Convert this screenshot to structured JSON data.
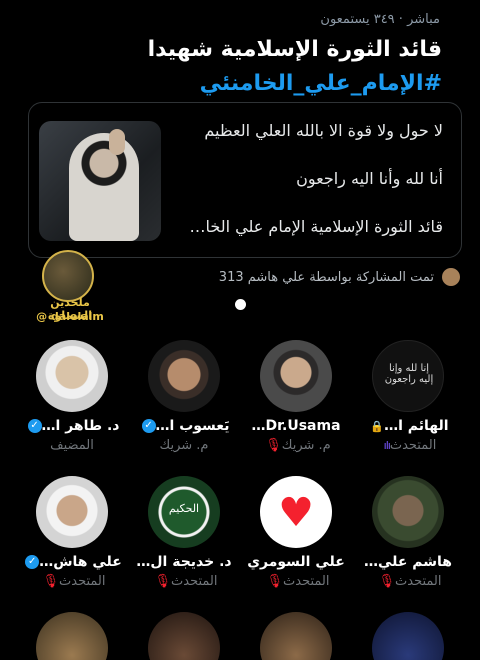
{
  "header": {
    "live_label": "مباشر",
    "listeners": "· ٣٤٩ يستمعون",
    "title": "قائد الثورة الإسلامية شهيدا",
    "hashtag": "#الإمام_علي_الخامنئي"
  },
  "card": {
    "line1": "لا حول ولا قوة الا بالله العلي العظيم",
    "line2": "أنا لله وأنا اليه راجعون",
    "line3": "قائد الثورة الإسلامية الإمام علي الخا…"
  },
  "watermark": {
    "line1": "ملحدين السماوة",
    "line2": "@ dalelalm"
  },
  "shared": {
    "text": "تمت المشاركة بواسطة علي هاشم 313"
  },
  "speakers": [
    {
      "name": "الهائم ا…",
      "role": "المتحدث",
      "badge": "lock",
      "status": "wave",
      "calligraphy": "إنا لله وإنا إليه راجعون"
    },
    {
      "name": "Dr.Usama…",
      "role": "م. شريك",
      "badge": "",
      "status": "mic-off"
    },
    {
      "name": "يَعسوب ا…",
      "role": "م. شريك",
      "badge": "verified",
      "status": ""
    },
    {
      "name": "د. طاهر ا…",
      "role": "المضيف",
      "badge": "verified",
      "status": ""
    },
    {
      "name": "هاشم علي…",
      "role": "المتحدث",
      "badge": "",
      "status": "mic-off"
    },
    {
      "name": "علي السومري",
      "role": "المتحدث",
      "badge": "",
      "status": "mic-off"
    },
    {
      "name": "د. خديجة ال…",
      "role": "المتحدث",
      "badge": "",
      "status": "mic-off",
      "calligraphy": "الحكيم"
    },
    {
      "name": "علي هاش…",
      "role": "المتحدث",
      "badge": "verified",
      "status": "mic-off"
    }
  ],
  "icons": {
    "verified": "✓",
    "lock": "🔒",
    "mic_off": "🎙",
    "wave": "ılı",
    "heart": "♥"
  },
  "colors": {
    "accent": "#1d9bf0",
    "muted": "#71767b",
    "danger": "#f4212e",
    "watermark": "#e8c547"
  }
}
